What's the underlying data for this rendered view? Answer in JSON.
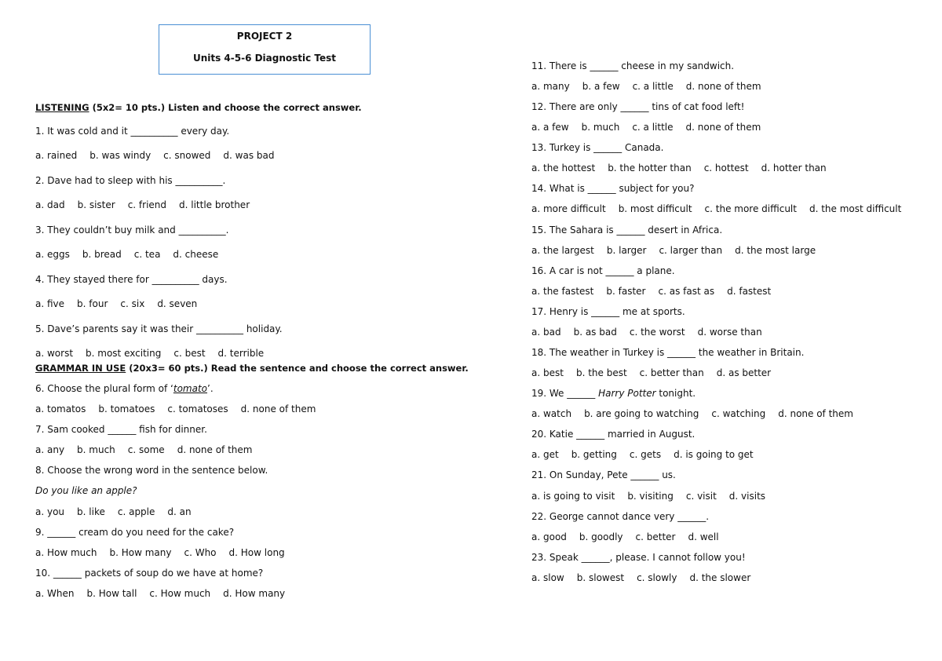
{
  "header": {
    "title": "PROJECT 2",
    "subtitle": "Units 4-5-6 Diagnostic Test",
    "border_color": "#4a8fd4"
  },
  "listening": {
    "heading": "LISTENING",
    "heading_rest": " (5x2= 10 pts.) Listen and choose the correct answer."
  },
  "grammar": {
    "heading": "GRAMMAR IN USE",
    "heading_rest": " (20x3= 60 pts.) Read the sentence and choose the correct answer."
  },
  "questions": [
    {
      "q": "1.  It was cold and it __________ every day.",
      "options": [
        "a. rained",
        "b. was windy",
        "c. snowed",
        "d. was bad"
      ]
    },
    {
      "q": "2. Dave had to sleep with his __________.",
      "options": [
        "a. dad",
        "b. sister",
        "c. friend",
        "d. little brother"
      ]
    },
    {
      "q": "3. They couldn’t buy milk and __________.",
      "options": [
        "a. eggs",
        "b. bread",
        "c. tea",
        "d. cheese"
      ]
    },
    {
      "q": "4. They stayed there for __________ days.",
      "options": [
        "a. five",
        "b. four",
        "c. six",
        "d. seven"
      ]
    },
    {
      "q": "5. Dave’s parents say it was their __________ holiday.",
      "options": [
        "a. worst",
        "b. most exciting",
        "c. best",
        "d. terrible"
      ]
    },
    {
      "q_pre": "6. Choose the plural form of ‘",
      "q_em": "tomato",
      "q_post": "’.",
      "options": [
        "a. tomatos",
        "b. tomatoes",
        "c. tomatoses",
        "d. none of them"
      ]
    },
    {
      "q": "7. Sam cooked ______ fish for dinner.",
      "options": [
        "a. any",
        "b. much",
        "c. some",
        "d. none of them"
      ]
    },
    {
      "q": "8. Choose the wrong word in the sentence below.",
      "sentence": "Do you like an apple?",
      "options": [
        "a. you",
        "b. like",
        "c. apple",
        "d. an"
      ]
    },
    {
      "q": "9. ______ cream do you need for the cake?",
      "options": [
        "a. How much",
        "b. How many",
        "c. Who",
        "d. How long"
      ]
    },
    {
      "q": "10. ______ packets of soup do we have at home?",
      "options": [
        "a. When",
        "b. How tall",
        "c. How much",
        "d. How many"
      ]
    },
    {
      "q": "11. There is ______ cheese in my sandwich.",
      "options": [
        "a. many",
        "b. a few",
        "c. a little",
        "d. none of them"
      ]
    },
    {
      "q": "12. There are only ______ tins of cat food left!",
      "options": [
        "a. a few",
        "b. much",
        "c. a little",
        "d. none of them"
      ]
    },
    {
      "q": "13. Turkey is ______ Canada.",
      "options": [
        "a. the hottest",
        "b. the hotter than",
        "c. hottest",
        "d. hotter than"
      ]
    },
    {
      "q": "14. What is ______ subject for you?",
      "options": [
        "a. more difficult",
        "b. most difficult",
        "c. the more difficult",
        "d. the most difficult"
      ]
    },
    {
      "q": "15. The Sahara is ______ desert in Africa.",
      "options": [
        "a. the largest",
        "b. larger",
        "c. larger than",
        "d. the most large"
      ]
    },
    {
      "q": "16. A car is not ______ a plane.",
      "options": [
        "a. the fastest",
        "b. faster",
        "c. as fast as",
        "d. fastest"
      ]
    },
    {
      "q": "17. Henry is ______ me at sports.",
      "options": [
        "a. bad",
        "b. as bad",
        "c. the worst",
        "d. worse than"
      ]
    },
    {
      "q": "18. The weather in Turkey is ______ the weather in Britain.",
      "options": [
        "a. best",
        "b. the best",
        "c. better than",
        "d. as better"
      ]
    },
    {
      "q_pre": "19. We ______ ",
      "q_em": "Harry Potter",
      "q_post": " tonight.",
      "options": [
        "a. watch",
        "b. are going to watching",
        "c. watching",
        "d. none of them"
      ]
    },
    {
      "q": "20. Katie ______ married in August.",
      "options": [
        "a. get",
        "b. getting",
        "c. gets",
        "d. is going to get"
      ]
    },
    {
      "q": "21. On Sunday, Pete ______ us.",
      "options": [
        "a. is going to visit",
        "b. visiting",
        "c. visit",
        "d. visits"
      ]
    },
    {
      "q": "22. George cannot dance very ______.",
      "options": [
        "a. good",
        "b. goodly",
        "c. better",
        "d. well"
      ]
    },
    {
      "q": "23. Speak ______, please. I cannot follow you!",
      "options": [
        "a. slow",
        "b. slowest",
        "c. slowly",
        "d. the slower"
      ]
    }
  ]
}
